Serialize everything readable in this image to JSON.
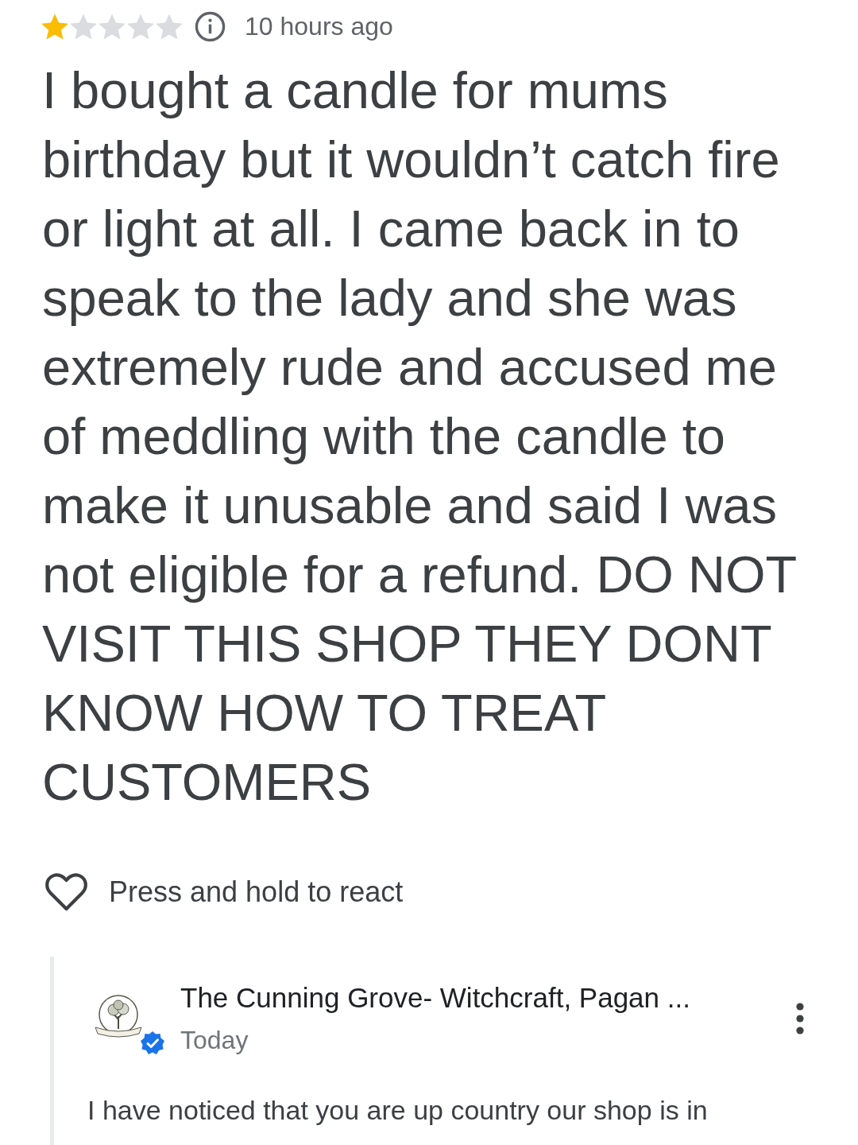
{
  "review": {
    "stars": 1,
    "time": "10 hours ago",
    "text": "I bought a candle for mums birthday but it wouldn’t catch fire or light at all. I came back in to speak to the lady and she was extremely rude and accused me of meddling with the candle to make it unusable and said I was not eligible for a refund. DO NOT VISIT THIS SHOP THEY DONT KNOW HOW TO TREAT CUSTOMERS"
  },
  "reaction": {
    "label": "Press and hold to react"
  },
  "owner_reply": {
    "name": "The Cunning Grove- Witchcraft, Pagan ...",
    "verified": true,
    "time": "Today",
    "text": "I have noticed that you are up country our shop is in"
  }
}
